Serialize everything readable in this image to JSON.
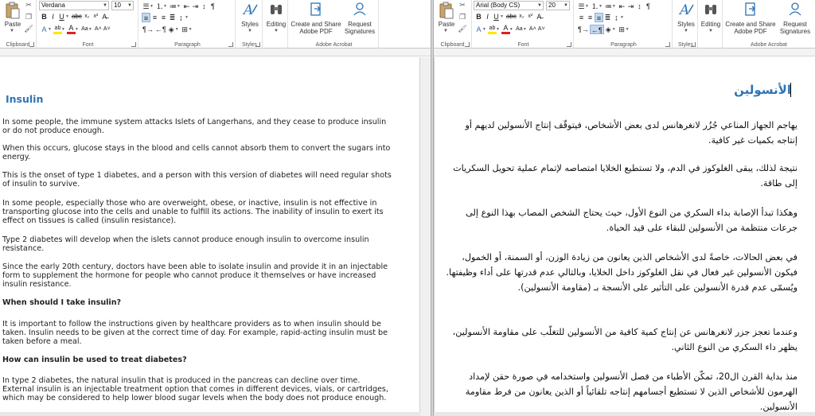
{
  "left": {
    "ribbon": {
      "paste_label": "Paste",
      "clipboard_label": "Clipboard",
      "font_name": "Verdana",
      "font_size": "10",
      "font_label": "Font",
      "paragraph_label": "Paragraph",
      "styles_label": "Styles",
      "styles_group_label": "Styles",
      "editing_label": "Editing",
      "create_share_line1": "Create and Share",
      "create_share_line2": "Adobe PDF",
      "request_line1": "Request",
      "request_line2": "Signatures",
      "acrobat_label": "Adobe Acrobat"
    },
    "doc": {
      "title": "Insulin",
      "p1": "In some people, the immune system attacks Islets of Langerhans, and they cease to produce insulin or do not produce enough.",
      "p2": "When this occurs, glucose stays in the blood and cells cannot absorb them to convert the sugars into energy.",
      "p3": "This is the onset of type 1 diabetes, and a person with this version of diabetes will need regular shots of insulin to survive.",
      "p4": "In some people, especially those who are overweight, obese, or inactive, insulin is not effective in transporting glucose into the cells and unable to fulfill its actions. The inability of insulin to exert its effect on tissues is called (insulin resistance).",
      "p5": "Type 2 diabetes will develop when the islets cannot produce enough insulin to overcome insulin resistance.",
      "p6": "Since the early 20th century, doctors have been able to isolate insulin and provide it in an injectable form to supplement the hormone for people who cannot produce it themselves or have increased insulin resistance.",
      "h2": "When should I take insulin?",
      "p7": "It is important to follow the instructions given by healthcare providers as to when insulin should be taken. Insulin needs to be given at the correct time of day. For example, rapid-acting insulin must be taken before a meal.",
      "h3": "How can insulin be used to treat diabetes?",
      "p8": "In type 2 diabetes, the natural insulin that is produced in the pancreas can decline over time. External insulin is an injectable treatment option that comes in different devices, vials, or cartridges, which may be considered to help lower blood sugar levels when the body does not produce enough."
    }
  },
  "right": {
    "ribbon": {
      "paste_label": "Paste",
      "clipboard_label": "Clipboard",
      "font_name": "Arial (Body CS)",
      "font_size": "20",
      "font_label": "Font",
      "paragraph_label": "Paragraph",
      "styles_label": "Styles",
      "styles_group_label": "Styles",
      "editing_label": "Editing",
      "create_share_line1": "Create and Share",
      "create_share_line2": "Adobe PDF",
      "request_line1": "Request",
      "request_line2": "Signatures",
      "acrobat_label": "Adobe Acrobat"
    },
    "doc": {
      "title": "الأنسولين",
      "p1": "يهاجم الجهاز المناعي جُزُر لانغرهانس لدى بعض الأشخاص، فيتوقّف إنتاج الأنسولين لديهم أو إنتاجه بكميات غير كافية.",
      "p2": "نتيجة لذلك، يبقى الغلوكوز في الدم، ولا تستطيع الخلايا امتصاصه لإتمام عملية تحويل السكريات إلى طاقة.",
      "p3": "وهكذا تبدأ الإصابة بداء السكري من النوع الأول، حيث يحتاج الشخص المصاب بهذا النوع إلى جرعات منتظمة من الأنسولين للبقاء على قيد الحياة.",
      "p4": "في بعض الحالات، خاصةً لدى الأشخاص الذين يعانون من زيادة الوزن، أو السمنة، أو الخمول، فيكون الأنسولين غير فعال في نقل الغلوكوز داخل الخلايا، وبالتالي عدم قدرتها على أداء وظيفتها. ويُسمّى عدم قدرة الأنسولين على التأثير على الأنسجة بـ (مقاومة الأنسولين).",
      "p5": "وعندما تعجز جزر لانغرهانس عن إنتاج كمية كافية من الأنسولين للتغلّب على مقاومة الأنسولين، يظهر داء السكري من النوع الثاني.",
      "p6": "منذ بداية القرن ال20، تمكّن الأطباء من فصل الأنسولين واستخدامه في صورة حقن لإمداد الهرمون للأشخاص الذين لا تستطيع أجسامهم إنتاجه تلقائياً أو الذين يعانون من فرط مقاومة الأنسولين."
    }
  },
  "colors": {
    "heading": "#2e74b5",
    "active_button": "#c5d8ef",
    "font_color_red": "#e02020",
    "highlight_yellow": "#ffe600"
  }
}
